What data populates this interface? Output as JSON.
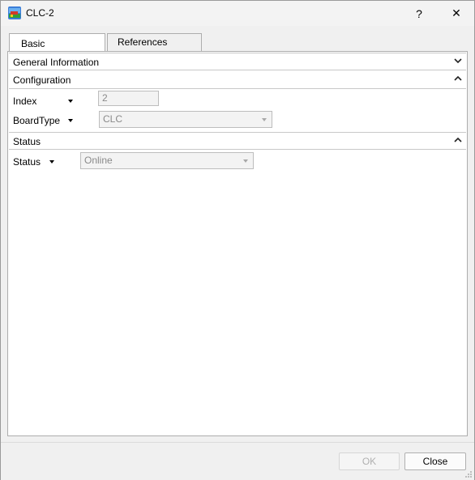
{
  "window": {
    "title": "CLC-2",
    "help_label": "?",
    "close_label": "✕"
  },
  "tabs": [
    {
      "label": "Basic"
    },
    {
      "label": "References"
    }
  ],
  "sections": {
    "general": {
      "label": "General Information"
    },
    "configuration": {
      "label": "Configuration"
    },
    "status": {
      "label": "Status"
    }
  },
  "fields": {
    "index": {
      "label": "Index",
      "value": "2"
    },
    "boardtype": {
      "label": "BoardType",
      "value": "CLC"
    },
    "status": {
      "label": "Status",
      "value": "Online"
    }
  },
  "footer": {
    "ok_label": "OK",
    "close_label": "Close"
  }
}
